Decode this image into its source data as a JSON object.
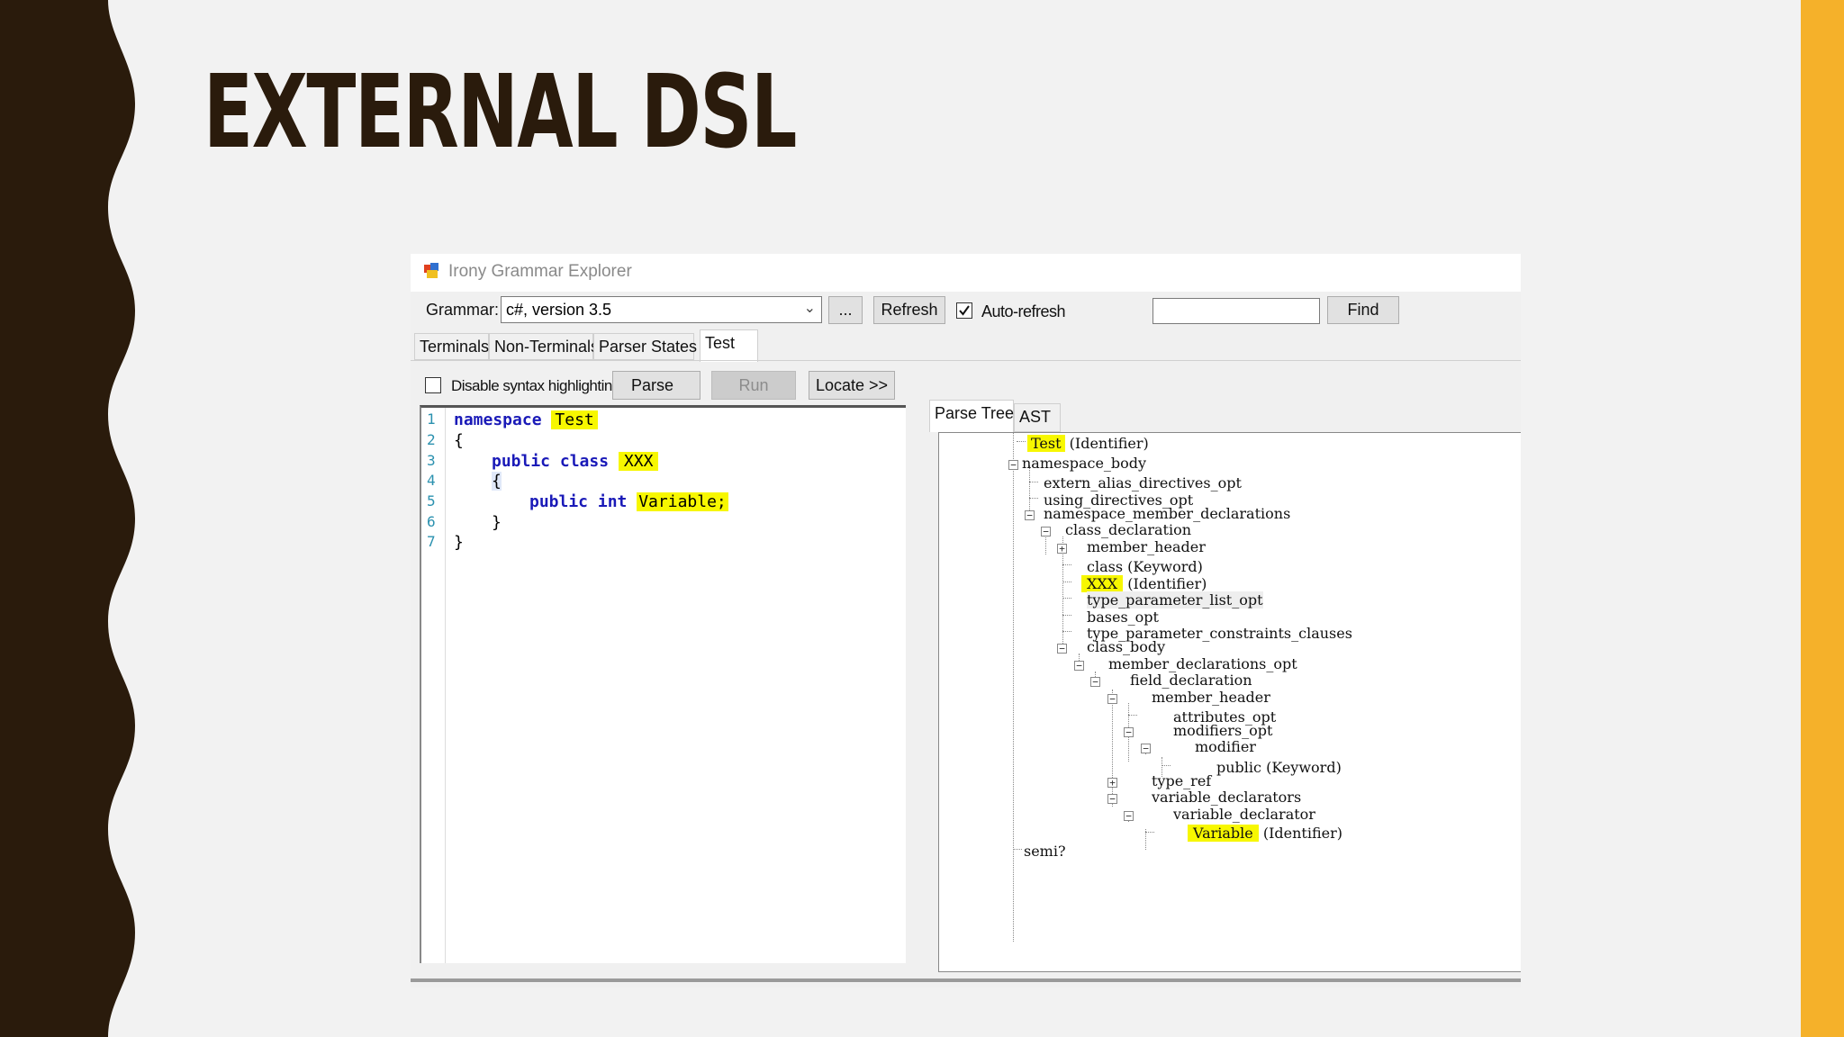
{
  "slide": {
    "title": "EXTERNAL DSL"
  },
  "colors": {
    "accent": "#f5b12a",
    "wave": "#2a1b0c",
    "highlight": "#f7f700"
  },
  "window": {
    "title": "Irony Grammar Explorer"
  },
  "toolbar": {
    "grammar_label": "Grammar:",
    "grammar_value": "c#, version 3.5",
    "browse_label": "...",
    "refresh_label": "Refresh",
    "autorefresh_label": "Auto-refresh",
    "autorefresh_checked": true,
    "search_value": "",
    "find_label": "Find"
  },
  "tabs": [
    "Terminals",
    "Non-Terminals",
    "Parser States",
    "Test"
  ],
  "test_panel": {
    "disable_highlighting_label": "Disable syntax highlighting",
    "parse_label": "Parse",
    "run_label": "Run",
    "locate_label": "Locate >>"
  },
  "editor": {
    "line_numbers": [
      "1",
      "2",
      "3",
      "4",
      "5",
      "6",
      "7"
    ],
    "lines": [
      {
        "kw": "namespace",
        "id": "Test"
      },
      {
        "text": "{"
      },
      {
        "kw": "public class",
        "id": "XXX"
      },
      {
        "text": "{"
      },
      {
        "kw": "public int",
        "id": "Variable;"
      },
      {
        "text": "}"
      },
      {
        "text": "}"
      }
    ]
  },
  "result_tabs": [
    "Parse Tree",
    "AST"
  ],
  "parse_tree": [
    {
      "name": "Test",
      "suffix": " (Identifier)"
    },
    {
      "name": "namespace_body",
      "suffix": ""
    },
    {
      "name": "extern_alias_directives_opt",
      "suffix": ""
    },
    {
      "name": "using_directives_opt",
      "suffix": ""
    },
    {
      "name": "namespace_member_declarations",
      "suffix": ""
    },
    {
      "name": "class_declaration",
      "suffix": ""
    },
    {
      "name": "member_header",
      "suffix": ""
    },
    {
      "name": "class",
      "suffix": " (Keyword)"
    },
    {
      "name": "XXX",
      "suffix": " (Identifier)"
    },
    {
      "name": "type_parameter_list_opt",
      "suffix": ""
    },
    {
      "name": "bases_opt",
      "suffix": ""
    },
    {
      "name": "type_parameter_constraints_clauses",
      "suffix": ""
    },
    {
      "name": "class_body",
      "suffix": ""
    },
    {
      "name": "member_declarations_opt",
      "suffix": ""
    },
    {
      "name": "field_declaration",
      "suffix": ""
    },
    {
      "name": "member_header",
      "suffix": ""
    },
    {
      "name": "attributes_opt",
      "suffix": ""
    },
    {
      "name": "modifiers_opt",
      "suffix": ""
    },
    {
      "name": "modifier",
      "suffix": ""
    },
    {
      "name": "public",
      "suffix": " (Keyword)"
    },
    {
      "name": "type_ref",
      "suffix": ""
    },
    {
      "name": "variable_declarators",
      "suffix": ""
    },
    {
      "name": "variable_declarator",
      "suffix": ""
    },
    {
      "name": "Variable",
      "suffix": " (Identifier)"
    },
    {
      "name": "semi?",
      "suffix": ""
    }
  ]
}
